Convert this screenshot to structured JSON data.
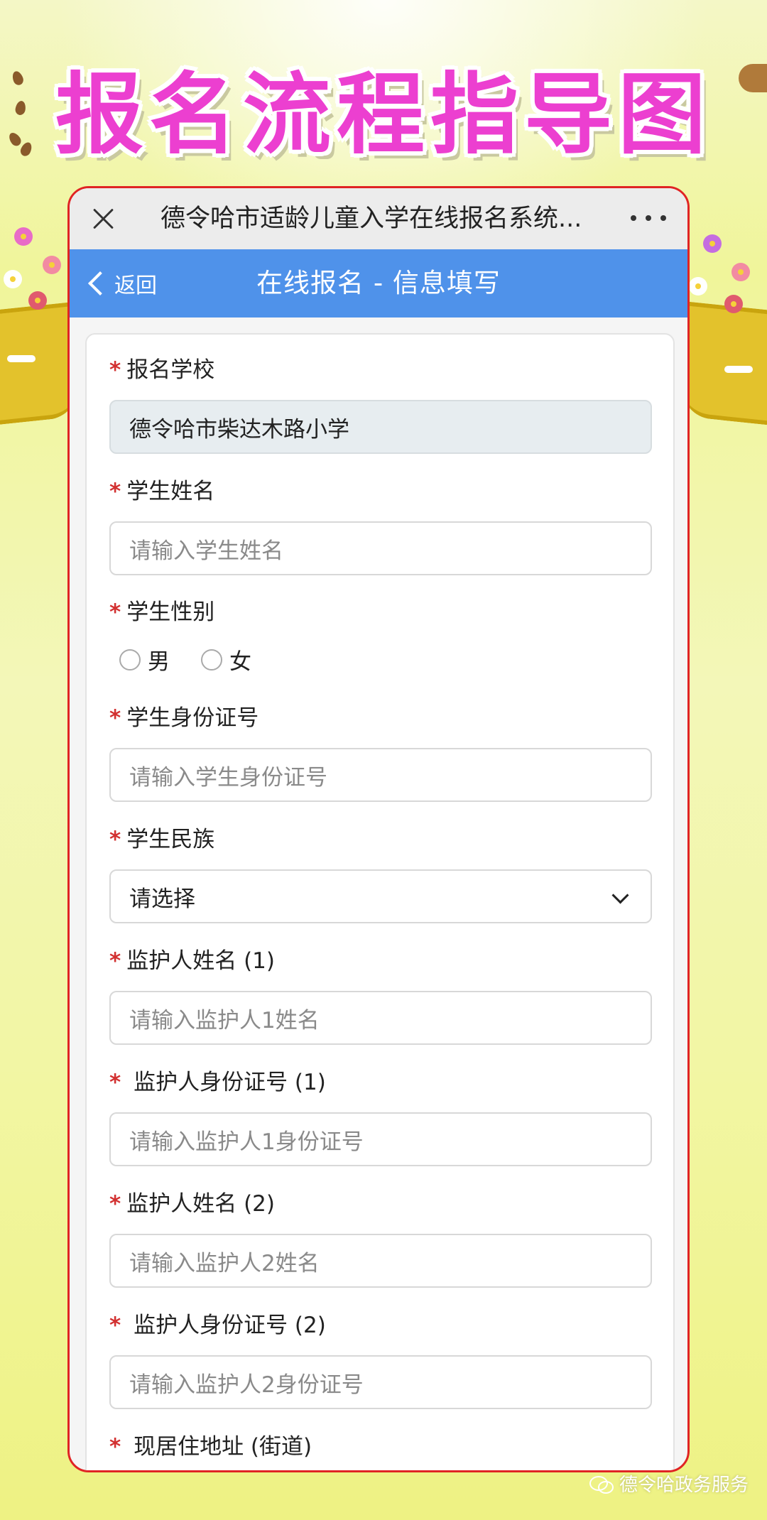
{
  "banner": {
    "title": "报名流程指导图"
  },
  "app": {
    "title": "德令哈市适龄儿童入学在线报名系统..."
  },
  "nav": {
    "back_label": "返回",
    "title": "在线报名 - 信息填写"
  },
  "form": {
    "school": {
      "label": "报名学校",
      "value": "德令哈市柴达木路小学"
    },
    "student_name": {
      "label": "学生姓名",
      "placeholder": "请输入学生姓名"
    },
    "gender": {
      "label": "学生性别",
      "options": [
        "男",
        "女"
      ]
    },
    "student_id": {
      "label": "学生身份证号",
      "placeholder": "请输入学生身份证号"
    },
    "ethnicity": {
      "label": "学生民族",
      "value": "请选择"
    },
    "guardian1_name": {
      "label": "监护人姓名 (1)",
      "placeholder": "请输入监护人1姓名"
    },
    "guardian1_id": {
      "label": " 监护人身份证号 (1)",
      "placeholder": "请输入监护人1身份证号"
    },
    "guardian2_name": {
      "label": "监护人姓名 (2)",
      "placeholder": "请输入监护人2姓名"
    },
    "guardian2_id": {
      "label": " 监护人身份证号 (2)",
      "placeholder": "请输入监护人2身份证号"
    },
    "address": {
      "label": " 现居住地址 (街道)"
    },
    "required_mark": "*"
  },
  "watermark": {
    "text": "德令哈政务服务"
  },
  "colors": {
    "accent": "#4f92ea",
    "title_pink": "#ec3fd0",
    "required": "#d23030",
    "frame": "#e02424"
  }
}
